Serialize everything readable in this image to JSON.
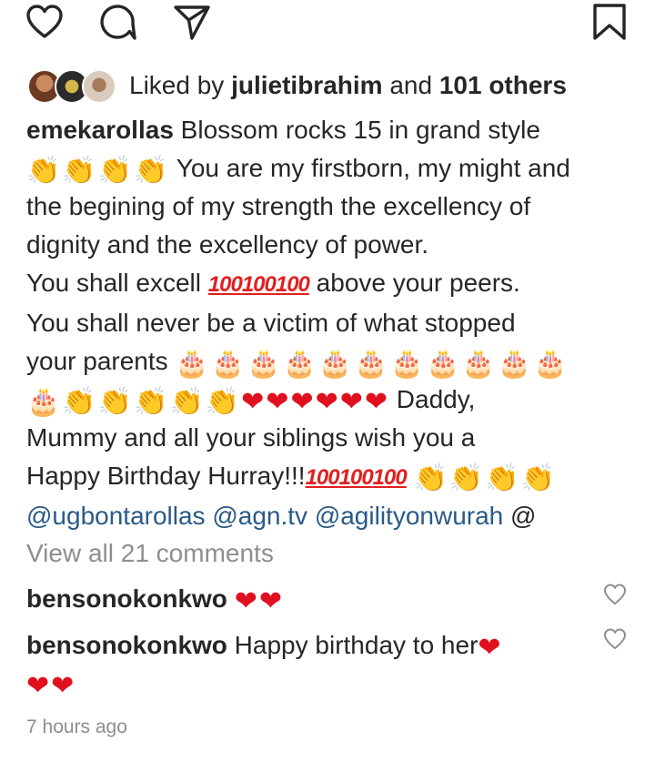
{
  "icons": {
    "like": "heart-outline-icon",
    "comment": "comment-bubble-icon",
    "share": "paper-plane-icon",
    "save": "bookmark-icon"
  },
  "likes": {
    "prefix": "Liked by ",
    "user": "julietibrahim",
    "middle": " and ",
    "others": "101 others"
  },
  "caption": {
    "username": "emekarollas",
    "lines": [
      " Blossom rocks 15 in grand style",
      " You are my firstborn, my might and",
      "the begining of my strength  the excellency of",
      "dignity and the excellency of power.",
      "You shall excell ",
      " above your peers.",
      "You shall never be a victim of what stopped",
      "your parents ",
      " Daddy,",
      "Mummy and all your siblings wish you a",
      "Happy Birthday  Hurray!!!"
    ],
    "emoji": {
      "clap": "👏",
      "heart": "❤",
      "cake": "🎂",
      "hundred": "100"
    },
    "mentions": [
      "@ugbontarollas",
      "@agn.tv",
      "@agilityonwurah",
      "@"
    ]
  },
  "view_all": "View all 21 comments",
  "comments": [
    {
      "username": "bensonokonkwo",
      "text": ""
    },
    {
      "username": "bensonokonkwo",
      "text": " Happy birthday to her"
    }
  ],
  "time": "7 hours ago",
  "colors": {
    "text": "#262626",
    "muted": "#8e8e8e",
    "mention": "#2a5a86",
    "heart": "#e0101e"
  }
}
